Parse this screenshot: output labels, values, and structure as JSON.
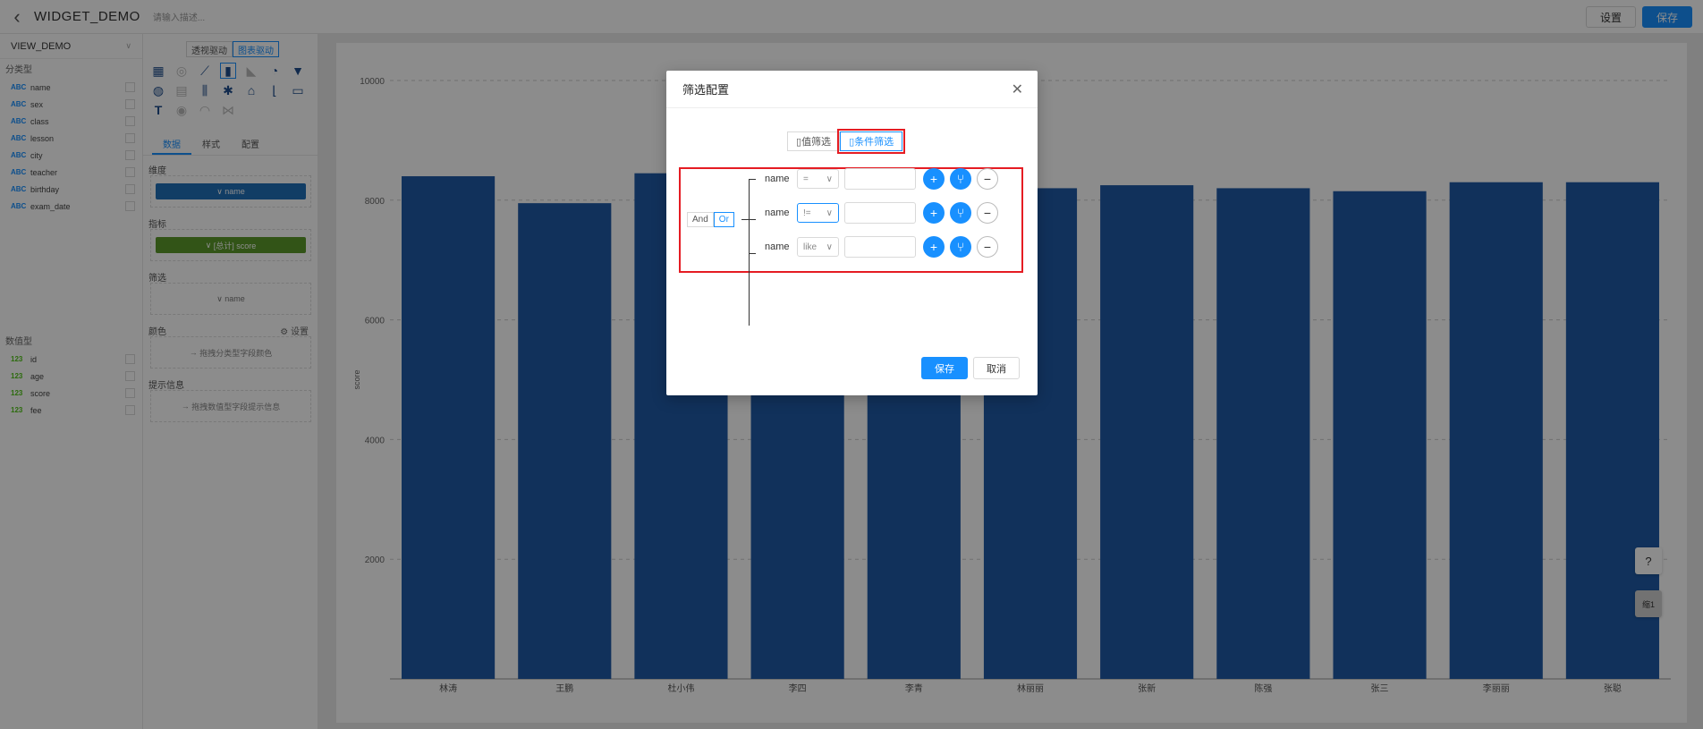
{
  "header": {
    "title": "WIDGET_DEMO",
    "description_placeholder": "请输入描述...",
    "settings_label": "设置",
    "save_label": "保存"
  },
  "left_panel": {
    "view": "VIEW_DEMO",
    "category_title": "分类型",
    "category_tag": "ABC",
    "category_fields": [
      "name",
      "sex",
      "class",
      "lesson",
      "city",
      "teacher",
      "birthday",
      "exam_date"
    ],
    "numeric_title": "数值型",
    "numeric_tag": "123",
    "numeric_fields": [
      "id",
      "age",
      "score",
      "fee"
    ]
  },
  "config_panel": {
    "mode_pure": "透视驱动",
    "mode_chart": "图表驱动",
    "tabs": [
      "数据",
      "样式",
      "配置"
    ],
    "dimension_label": "维度",
    "dimension_pill": "name",
    "metric_label": "指标",
    "metric_pill": "[总计] score",
    "filter_label": "筛选",
    "filter_pill": "name",
    "color_label": "颜色",
    "color_settings": "设置",
    "color_hint": "拖拽分类型字段颜色",
    "tooltip_label": "提示信息",
    "tooltip_hint": "拖拽数值型字段提示信息"
  },
  "modal": {
    "title": "筛选配置",
    "tab_value": "值筛选",
    "tab_condition": "条件筛选",
    "and_label": "And",
    "or_label": "Or",
    "conditions": [
      {
        "field": "name",
        "operator": "="
      },
      {
        "field": "name",
        "operator": "!="
      },
      {
        "field": "name",
        "operator": "like"
      }
    ],
    "save_label": "保存",
    "cancel_label": "取消"
  },
  "floating": {
    "help": "?",
    "zoom": "缩1"
  },
  "chart_data": {
    "type": "bar",
    "categories": [
      "林涛",
      "王鹏",
      "杜小伟",
      "李四",
      "李青",
      "林丽丽",
      "张新",
      "陈强",
      "张三",
      "李丽丽",
      "张聪"
    ],
    "values": [
      8400,
      7950,
      8450,
      8200,
      8250,
      8200,
      8250,
      8200,
      8150,
      8300,
      8300
    ],
    "ylabel": "score",
    "ylim": [
      0,
      10000
    ],
    "yticks": [
      2000,
      4000,
      6000,
      8000,
      10000
    ],
    "bar_color": "#1f5aa6",
    "grid": true
  }
}
